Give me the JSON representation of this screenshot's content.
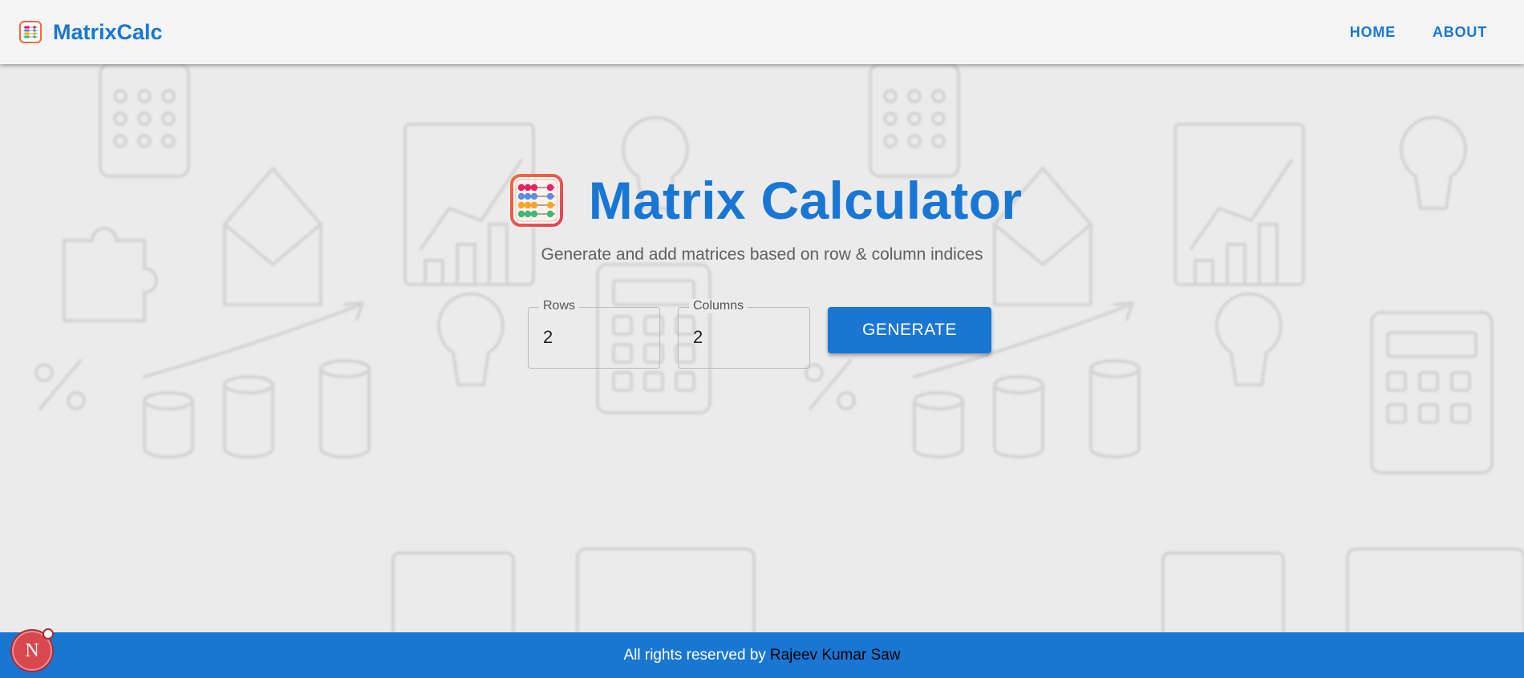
{
  "header": {
    "brand_name": "MatrixCalc",
    "brand_icon": "abacus-icon",
    "nav": [
      "HOME",
      "ABOUT"
    ]
  },
  "hero": {
    "icon": "abacus-icon",
    "title": "Matrix Calculator",
    "subtitle": "Generate and add matrices based on row & column indices"
  },
  "form": {
    "rows_label": "Rows",
    "rows_value": "2",
    "columns_label": "Columns",
    "columns_value": "2",
    "generate_label": "GENERATE"
  },
  "footer": {
    "text": "All rights reserved by",
    "author": "Rajeev Kumar Saw"
  },
  "badge": {
    "letter": "N",
    "icon": "next-dev-indicator-icon"
  },
  "colors": {
    "primary": "#1976d2",
    "header_bg": "#f5f5f5",
    "background": "#ebebeb",
    "footer_bg": "#1976d2",
    "badge": "#d9474f"
  }
}
